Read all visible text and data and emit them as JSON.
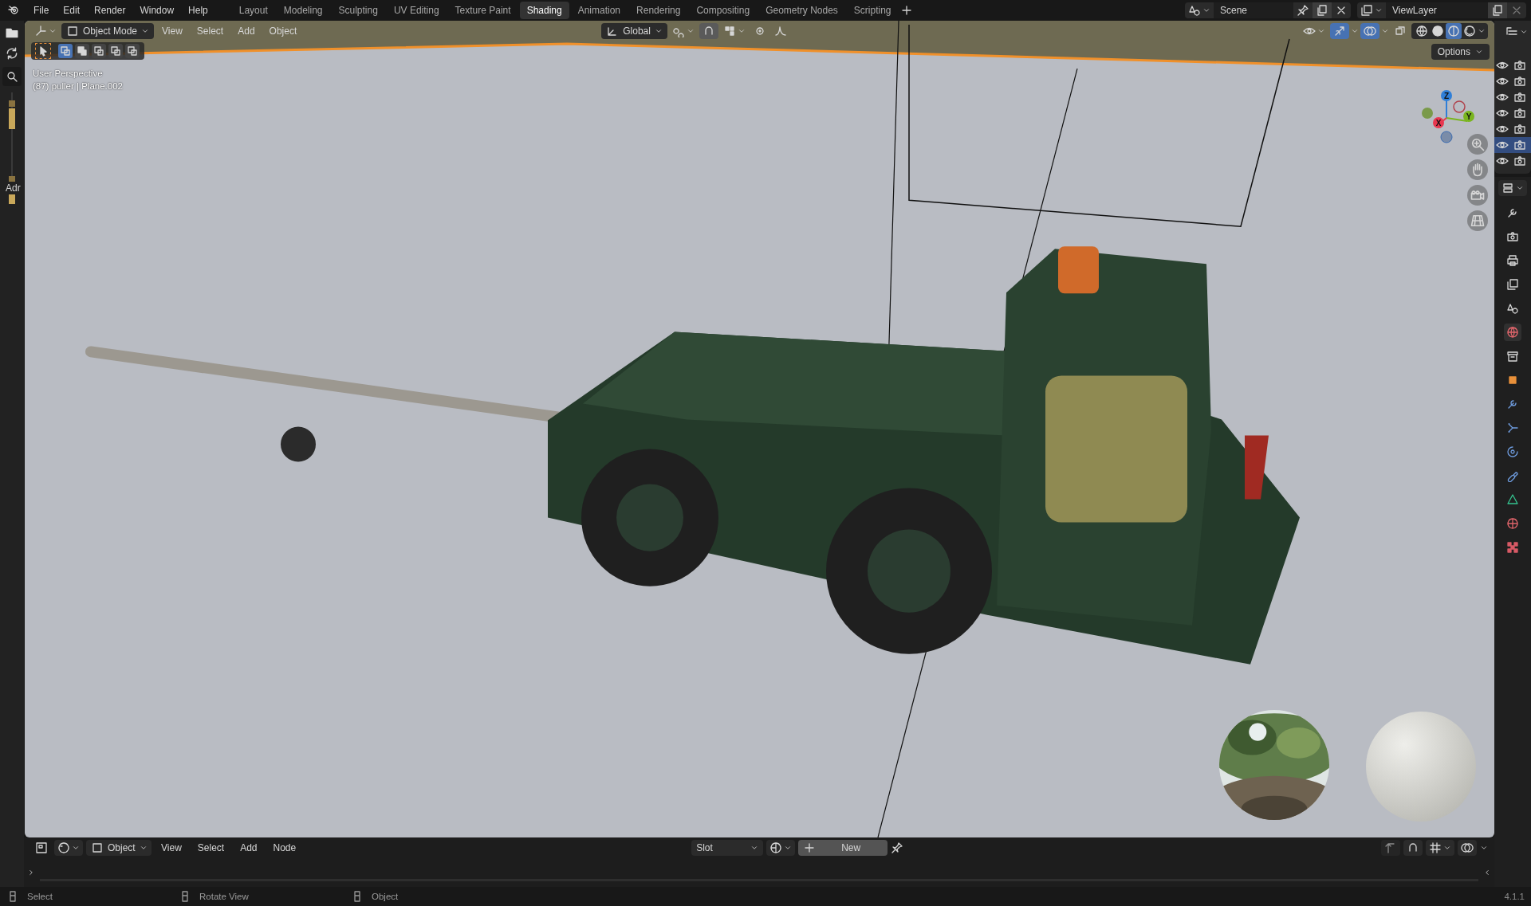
{
  "menu": [
    "File",
    "Edit",
    "Render",
    "Window",
    "Help"
  ],
  "workspaces": [
    {
      "label": "Layout",
      "selected": false
    },
    {
      "label": "Modeling",
      "selected": false
    },
    {
      "label": "Sculpting",
      "selected": false
    },
    {
      "label": "UV Editing",
      "selected": false
    },
    {
      "label": "Texture Paint",
      "selected": false
    },
    {
      "label": "Shading",
      "selected": true
    },
    {
      "label": "Animation",
      "selected": false
    },
    {
      "label": "Rendering",
      "selected": false
    },
    {
      "label": "Compositing",
      "selected": false
    },
    {
      "label": "Geometry Nodes",
      "selected": false
    },
    {
      "label": "Scripting",
      "selected": false
    }
  ],
  "scene": {
    "name": "Scene"
  },
  "view_layer": {
    "name": "ViewLayer"
  },
  "left_panel": {
    "label": "Adr"
  },
  "viewport": {
    "mode": "Object Mode",
    "menus": [
      "View",
      "Select",
      "Add",
      "Object"
    ],
    "orientation": "Global",
    "select_modes": [
      {
        "selected": true
      },
      {
        "selected": false
      },
      {
        "selected": false
      },
      {
        "selected": false
      },
      {
        "selected": false
      }
    ],
    "shading": [
      {
        "kind": "wireframe",
        "selected": false
      },
      {
        "kind": "solid",
        "selected": false
      },
      {
        "kind": "material",
        "selected": true
      },
      {
        "kind": "rendered",
        "selected": false
      }
    ],
    "options": "Options",
    "info": [
      "User Perspective",
      "(87) puller | Plane.002"
    ],
    "axes": [
      {
        "label": "Z",
        "color": "#2f7fd8"
      },
      {
        "label": "Y",
        "color": "#7ab51f"
      },
      {
        "label": "X",
        "color": "#e8364f"
      }
    ]
  },
  "outliner": {
    "rows": [
      {
        "selected": false
      },
      {
        "selected": false
      },
      {
        "selected": false
      },
      {
        "selected": false
      },
      {
        "selected": false
      },
      {
        "selected": true
      },
      {
        "selected": false
      }
    ]
  },
  "properties_tabs": [
    {
      "kind": "tool",
      "selected": false
    },
    {
      "kind": "render",
      "selected": false
    },
    {
      "kind": "output",
      "selected": false
    },
    {
      "kind": "view_layer",
      "selected": false
    },
    {
      "kind": "scene",
      "selected": false
    },
    {
      "kind": "world",
      "selected": true
    },
    {
      "kind": "collection",
      "selected": false
    },
    {
      "kind": "object",
      "selected": false
    },
    {
      "kind": "modifiers",
      "selected": false
    },
    {
      "kind": "particles",
      "selected": false
    },
    {
      "kind": "physics",
      "selected": false
    },
    {
      "kind": "constraints",
      "selected": false
    },
    {
      "kind": "data",
      "selected": false
    },
    {
      "kind": "material",
      "selected": false
    },
    {
      "kind": "texture",
      "selected": false
    }
  ],
  "node_editor": {
    "mode": "Object",
    "menus": [
      "View",
      "Select",
      "Add",
      "Node"
    ],
    "slot": "Slot",
    "new_button": "New"
  },
  "status_bar": [
    {
      "label": "Select"
    },
    {
      "label": "Rotate View"
    },
    {
      "label": "Object"
    }
  ],
  "version": "4.1.1"
}
